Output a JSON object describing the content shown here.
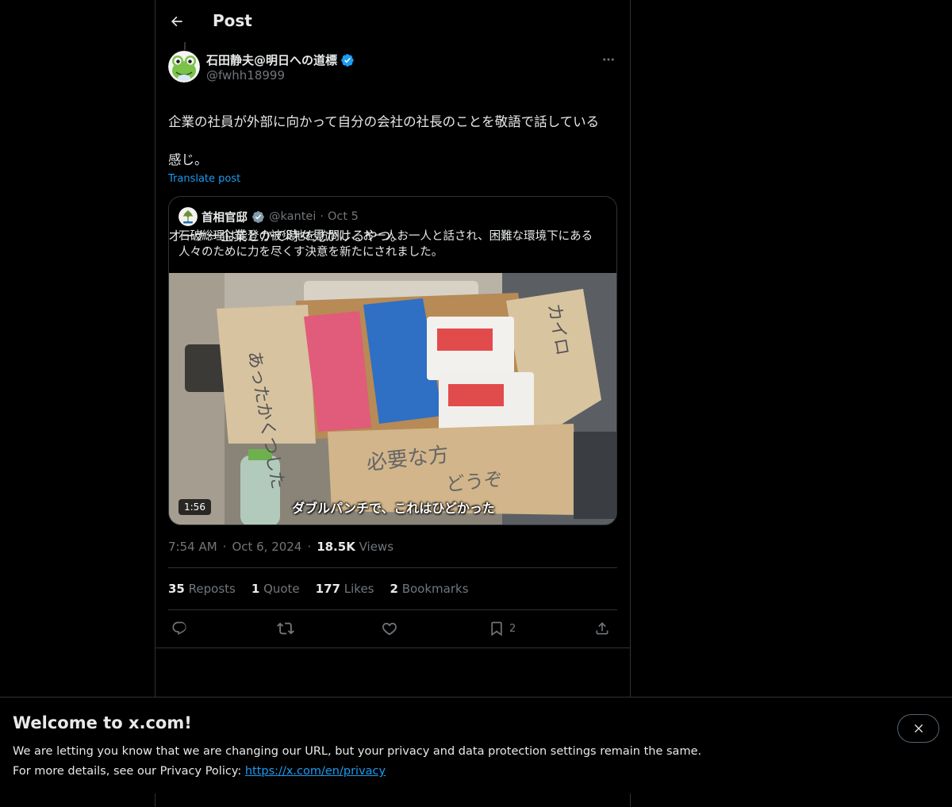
{
  "header": {
    "title": "Post"
  },
  "post": {
    "author_name": "石田静夫@明日への道標",
    "author_handle": "@fwhh18999",
    "text_line1": "企業の社員が外部に向かって自分の会社の社長のことを敬語で話している",
    "text_line2": "感じ。",
    "text_line3": "オーナー企業とかで時々見かけるやつ。",
    "translate_label": "Translate post",
    "time": "7:54 AM",
    "date": "Oct 6, 2024",
    "views_count": "18.5K",
    "views_label": "Views",
    "separator": "·"
  },
  "quote": {
    "author_name": "首相官邸",
    "author_handle": "@kantei",
    "separator": "·",
    "date": "Oct 5",
    "text": "石破総理は能登の被災地を訪問し、お一人お一人と話され、困難な環境下にある人々のために力を尽くす決意を新たにされました。",
    "video_duration": "1:56",
    "video_subtitle": "ダブルパンチで、これはひどかった",
    "box_label_left": "あったかくつした",
    "box_label_right": "カイロ",
    "box_label_front_1": "必要な方",
    "box_label_front_2": "どうぞ"
  },
  "stats": {
    "reposts_count": "35",
    "reposts_label": "Reposts",
    "quotes_count": "1",
    "quotes_label": "Quote",
    "likes_count": "177",
    "likes_label": "Likes",
    "bookmarks_count": "2",
    "bookmarks_label": "Bookmarks"
  },
  "actions": {
    "bookmark_count": "2"
  },
  "banner": {
    "title": "Welcome to x.com!",
    "line1": "We are letting you know that we are changing our URL, but your privacy and data protection settings remain the same.",
    "line2_prefix": "For more details, see our Privacy Policy: ",
    "link": "https://x.com/en/privacy"
  },
  "colors": {
    "background": "#000000",
    "text": "#e7e9ea",
    "secondary_text": "#71767b",
    "accent": "#1d9bf0",
    "border": "#2f3336"
  },
  "icons": [
    "back-arrow-icon",
    "verified-badge-icon",
    "more-icon",
    "reply-icon",
    "repost-icon",
    "like-icon",
    "bookmark-icon",
    "share-icon",
    "close-icon"
  ]
}
